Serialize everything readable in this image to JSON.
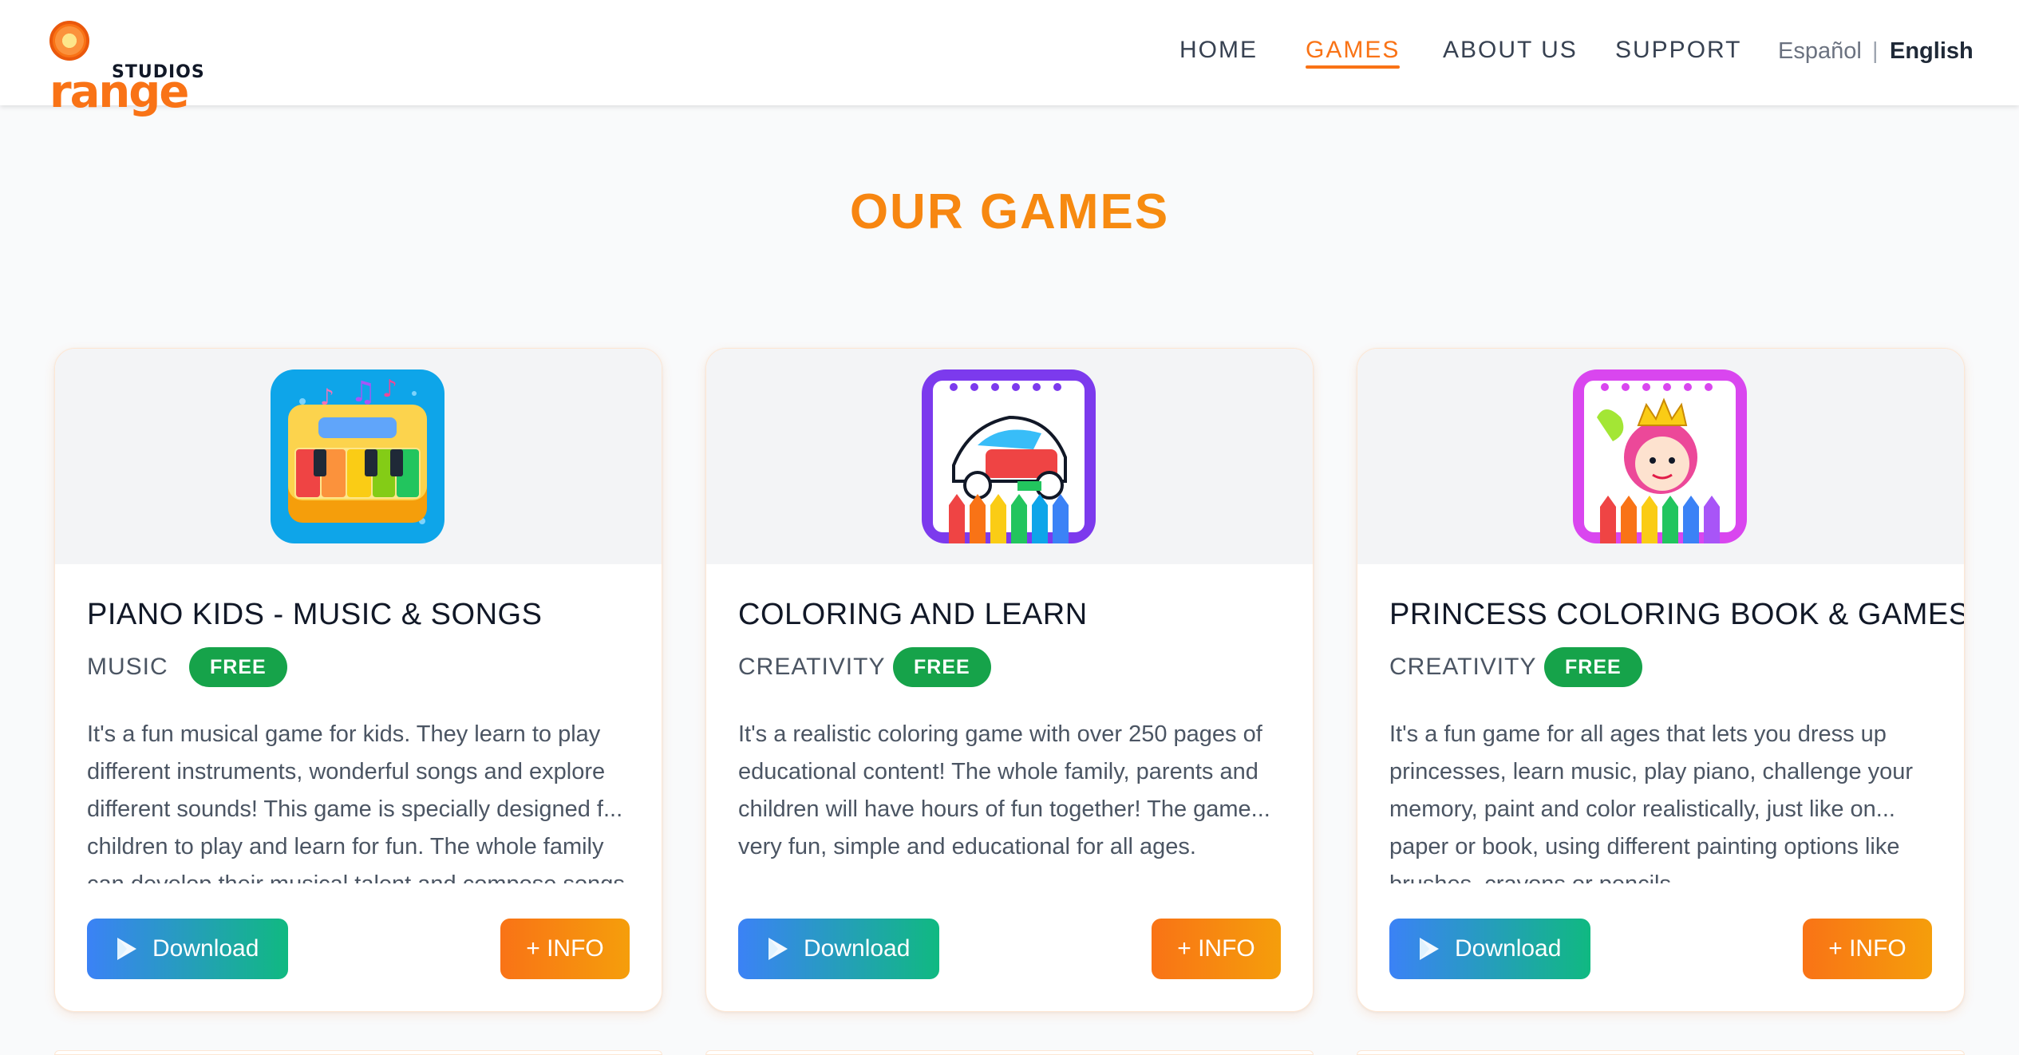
{
  "brand": {
    "logo_word": "range",
    "logo_sub": "STUDIOS"
  },
  "nav": {
    "items": [
      {
        "label": "HOME"
      },
      {
        "label": "GAMES"
      },
      {
        "label": "ABOUT US"
      },
      {
        "label": "SUPPORT"
      }
    ],
    "active": "GAMES",
    "languages": {
      "es": "Español",
      "separator": "|",
      "en": "English"
    }
  },
  "main": {
    "title": "OUR GAMES",
    "games": [
      {
        "title": "PIANO KIDS - MUSIC & SONGS",
        "category": "MUSIC",
        "badge": "FREE",
        "description": "It's a fun musical game for kids. They learn to play different instruments, wonderful songs and explore different sounds! This game is specially designed f... children to play and learn for fun. The whole family can develop their musical talent and compose songs",
        "download_label": "Download",
        "info_label": "+ INFO",
        "icon": "piano-app-icon"
      },
      {
        "title": "COLORING AND LEARN",
        "category": "CREATIVITY",
        "badge": "FREE",
        "description": "It's a realistic coloring game with over 250 pages of educational content! The whole family, parents and children will have hours of fun together! The game... very fun, simple and educational for all ages.",
        "download_label": "Download",
        "info_label": "+ INFO",
        "icon": "coloring-car-app-icon"
      },
      {
        "title": "PRINCESS COLORING BOOK & GAMES",
        "category": "CREATIVITY",
        "badge": "FREE",
        "description": "It's a fun game for all ages that lets you dress up princesses, learn music, play piano, challenge your memory, paint and color realistically, just like on... paper or book, using different painting options like brushes, crayons or pencils.",
        "download_label": "Download",
        "info_label": "+ INFO",
        "icon": "princess-app-icon"
      }
    ]
  },
  "colors": {
    "accent": "#f97316",
    "badge": "#16a34a",
    "download_from": "#3b82f6",
    "download_to": "#10b981"
  }
}
